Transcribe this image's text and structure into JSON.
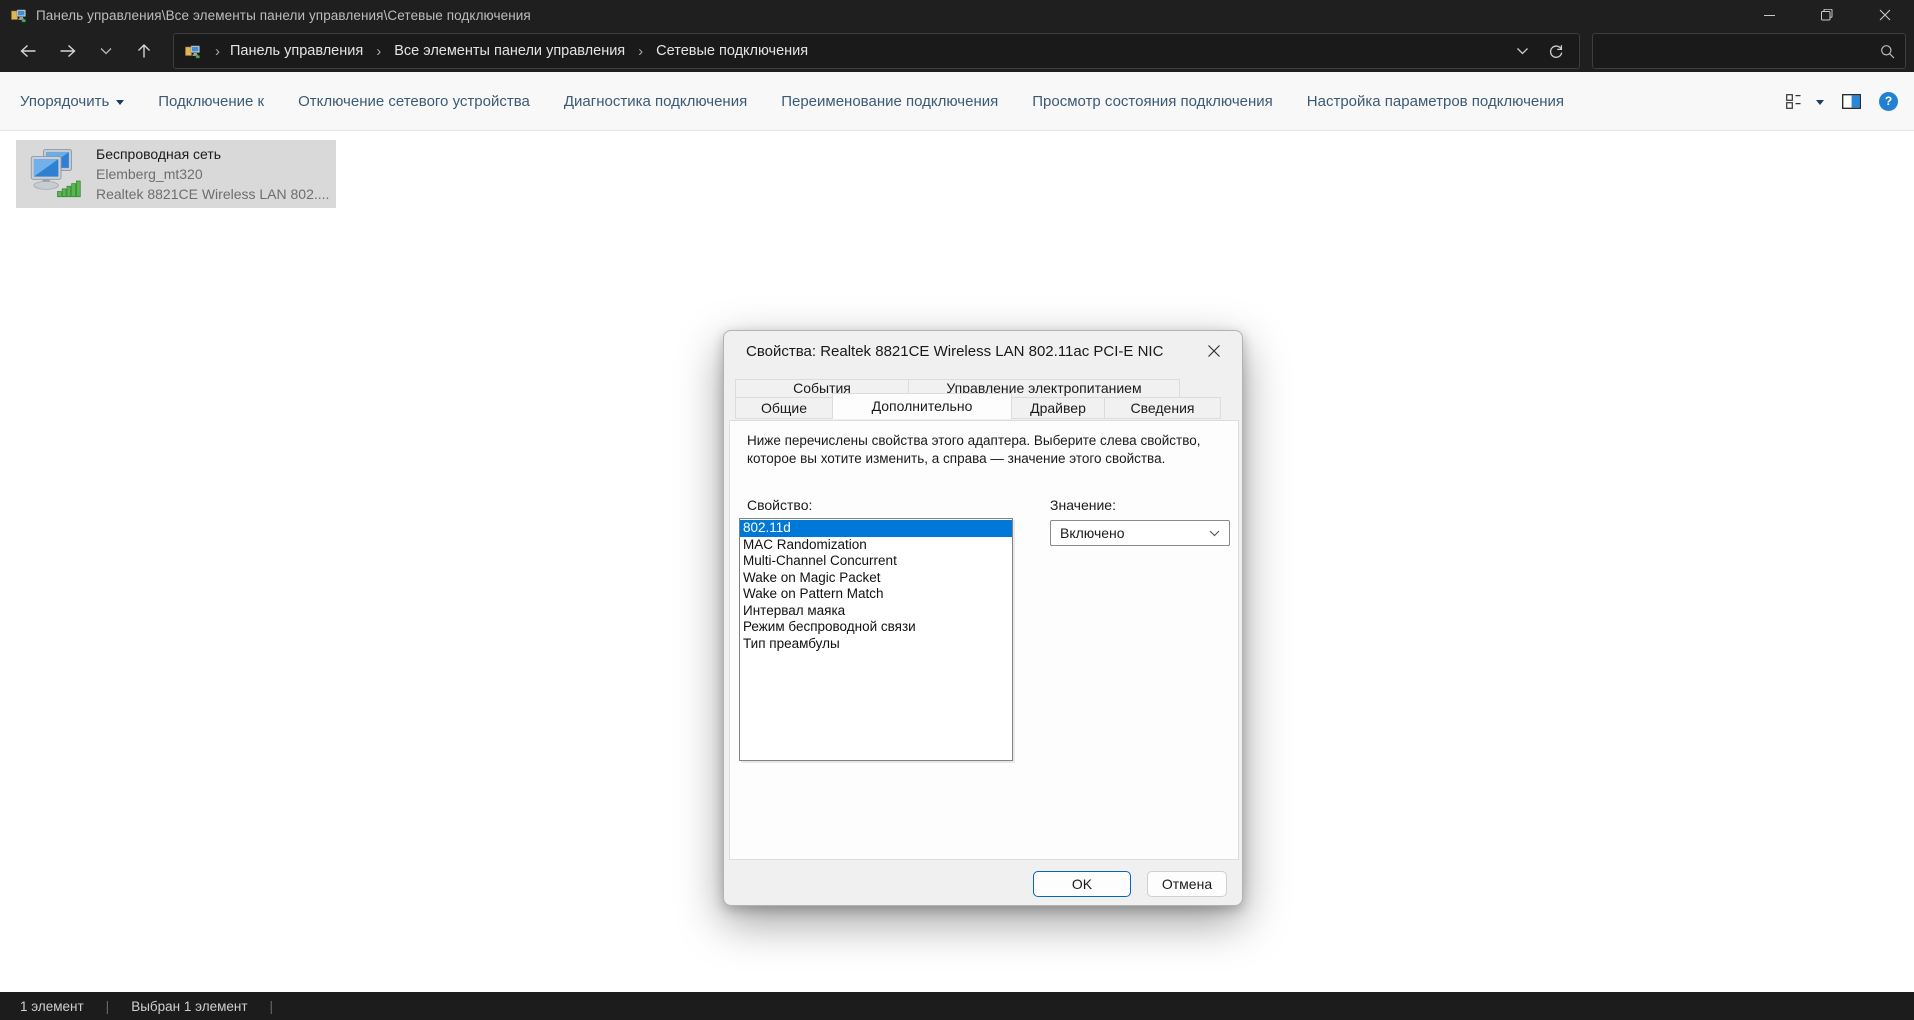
{
  "window": {
    "title": "Панель управления\\Все элементы панели управления\\Сетевые подключения"
  },
  "navbar": {
    "breadcrumb": [
      "Панель управления",
      "Все элементы панели управления",
      "Сетевые подключения"
    ],
    "separator": "›",
    "search_value": ""
  },
  "toolbar": {
    "items": [
      "Упорядочить",
      "Подключение к",
      "Отключение сетевого устройства",
      "Диагностика подключения",
      "Переименование подключения",
      "Просмотр состояния подключения",
      "Настройка параметров подключения"
    ]
  },
  "content": {
    "connection": {
      "name": "Беспроводная сеть",
      "network": "Elemberg_mt320",
      "adapter": "Realtek 8821CE Wireless LAN 802...."
    }
  },
  "dialog": {
    "title": "Свойства: Realtek 8821CE Wireless LAN 802.11ac PCI-E NIC",
    "tabs_row1": [
      "События",
      "Управление электропитанием"
    ],
    "tabs_row2": [
      "Общие",
      "Дополнительно",
      "Драйвер",
      "Сведения"
    ],
    "active_tab": "Дополнительно",
    "description_line1": "Ниже перечислены свойства этого адаптера. Выберите слева свойство,",
    "description_line2": "которое вы хотите изменить, а справа — значение этого свойства.",
    "property_label": "Свойство:",
    "value_label": "Значение:",
    "properties": [
      "802.11d",
      "MAC Randomization",
      "Multi-Channel Concurrent",
      "Wake on Magic Packet",
      "Wake on Pattern Match",
      "Интервал маяка",
      "Режим беспроводной связи",
      "Тип преамбулы"
    ],
    "selected_property": "802.11d",
    "value": "Включено",
    "ok_label": "OK",
    "cancel_label": "Отмена"
  },
  "statusbar": {
    "items_count": "1 элемент",
    "selected_count": "Выбран 1 элемент",
    "separator": "|"
  },
  "colors": {
    "accent": "#0078d7",
    "toolbar_link": "#3d5a75",
    "selection_bg": "#d9d9d9",
    "ok_button_border": "#0067c0",
    "help_icon_blue": "#2180d3",
    "titlebar_bg": "#1f1f1f"
  }
}
